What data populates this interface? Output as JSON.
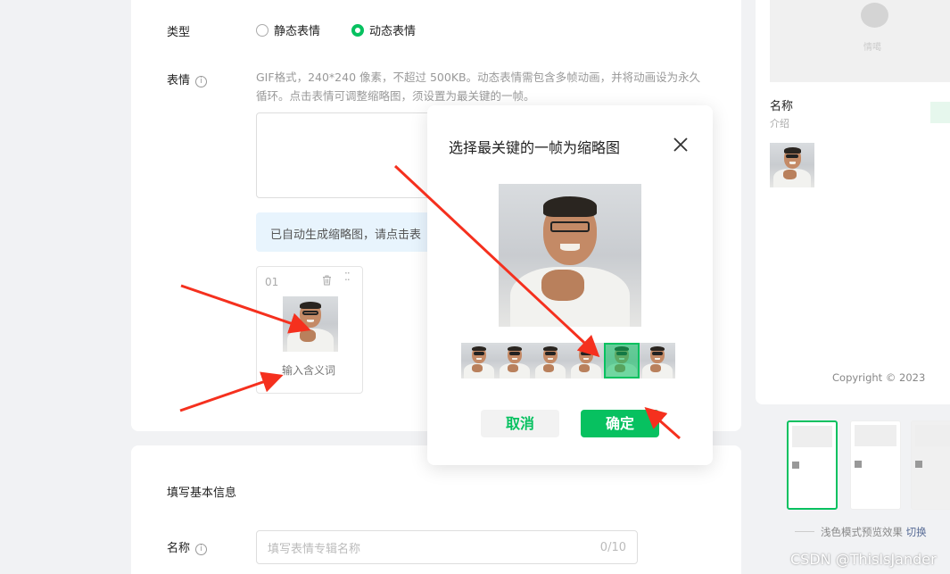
{
  "form": {
    "type_label": "类型",
    "type_options": [
      "静态表情",
      "动态表情"
    ],
    "selected_type": "动态表情",
    "sticker_label": "表情",
    "info_icon": "i",
    "hint": "GIF格式，240*240 像素，不超过 500KB。动态表情需包含多帧动画，并将动画设为永久循环。点击表情可调整缩略图，须设置为最关键的一帧。",
    "auto_thumb_notice": "已自动生成缩略图，请点击表",
    "sticker_card": {
      "index": "01",
      "meaning_placeholder": "输入含义词",
      "delete_icon": "trash-icon",
      "drag_icon": "drag-handle-icon"
    },
    "basic_section_title": "填写基本信息",
    "name_label": "名称",
    "name_placeholder": "填写表情专辑名称",
    "name_counter": "0/10"
  },
  "dialog": {
    "title": "选择最关键的一帧为缩略图",
    "frame_count": 6,
    "selected_frame": 4,
    "cancel_label": "取消",
    "confirm_label": "确定"
  },
  "preview": {
    "bubble_text": "情噶",
    "name": "名称",
    "intro": "介绍",
    "copyright": "Copyright © 2023",
    "mode_text": "浅色模式预览效果",
    "switch_label": "切换"
  },
  "watermark": "CSDN @ThisIsJander",
  "colors": {
    "accent": "#07c160",
    "arrow": "#f5301e",
    "link": "#576b95"
  }
}
